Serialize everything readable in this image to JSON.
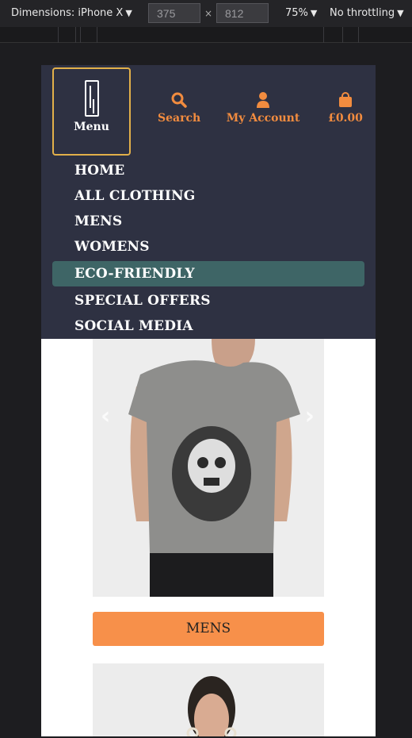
{
  "devtools": {
    "dimensions_label": "Dimensions: iPhone X",
    "width_value": "375",
    "height_value": "812",
    "times": "×",
    "zoom": "75%",
    "throttling": "No throttling",
    "caret": "▼"
  },
  "header": {
    "menu_label": "Menu",
    "search_label": "Search",
    "account_label": "My Account",
    "cart_label": "£0.00"
  },
  "nav": {
    "items": [
      "HOME",
      "ALL CLOTHING",
      "MENS",
      "WOMENS",
      "ECO-FRIENDLY",
      "SPECIAL OFFERS",
      "SOCIAL MEDIA"
    ],
    "active_item": "ECO-FRIENDLY"
  },
  "carousel": {
    "prev": "‹",
    "next": "›",
    "category_button": "MENS"
  },
  "colors": {
    "header_bg": "#2e3142",
    "accent_orange": "#f28c3f",
    "active_nav": "#3e6566",
    "menu_border": "#e2b04a"
  }
}
